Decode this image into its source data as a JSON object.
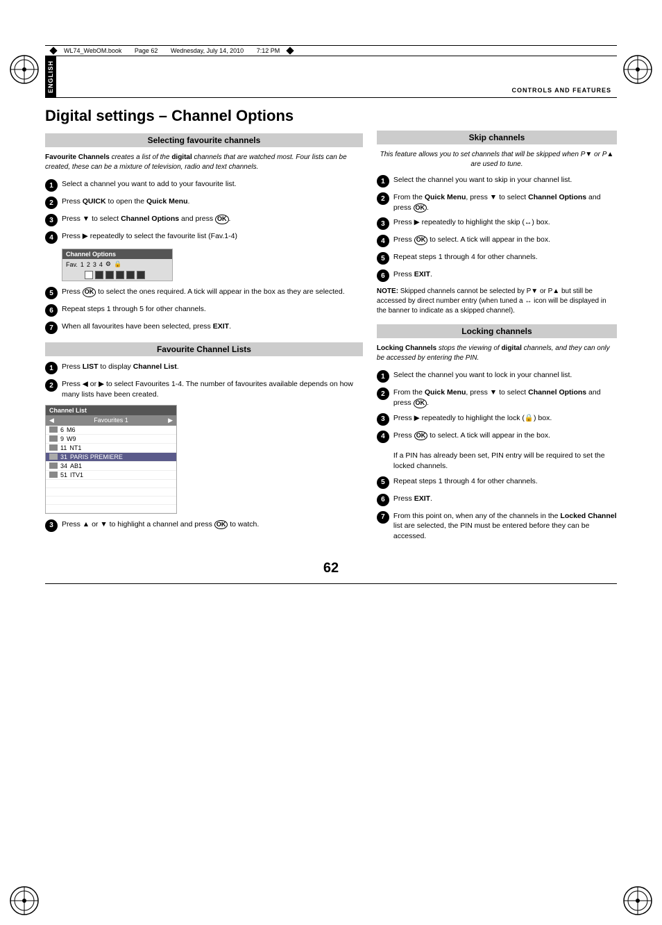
{
  "meta": {
    "file": "WL74_WebOM.book",
    "page": "Page 62",
    "date": "Wednesday, July 14, 2010",
    "time": "7:12 PM"
  },
  "section_label": "CONTROLS AND FEATURES",
  "tab_label": "English",
  "page_title": "Digital settings – Channel Options",
  "page_number": "62",
  "left": {
    "sections": [
      {
        "id": "selecting_favourite",
        "header": "Selecting favourite channels",
        "intro": "Favourite Channels creates a list of the digital channels that are watched most. Four lists can be created, these can be a mixture of television, radio and text channels.",
        "steps": [
          {
            "num": "1",
            "text": "Select a channel you want to add to your favourite list."
          },
          {
            "num": "2",
            "text": "Press QUICK to open the Quick Menu."
          },
          {
            "num": "3",
            "text": "Press ▼ to select Channel Options and press ⊙."
          },
          {
            "num": "4",
            "text": "Press ▶ repeatedly to select the favourite list (Fav.1-4)"
          },
          {
            "num": "5",
            "text": "Press ⊙ to select the ones required. A tick will appear in the box as they are selected."
          },
          {
            "num": "6",
            "text": "Repeat steps 1 through 5 for other channels."
          },
          {
            "num": "7",
            "text": "When all favourites have been selected, press EXIT."
          }
        ],
        "channel_options_box": {
          "title": "Channel Options",
          "row_label": "Fav.",
          "cols": [
            "1",
            "2",
            "3",
            "4",
            "⚙",
            "🔒"
          ],
          "squares": [
            "empty",
            "filled",
            "filled",
            "filled",
            "filled",
            "filled"
          ]
        }
      },
      {
        "id": "favourite_channel_lists",
        "header": "Favourite Channel Lists",
        "steps": [
          {
            "num": "1",
            "text": "Press LIST to display Channel List."
          },
          {
            "num": "2",
            "text": "Press ◀ or ▶ to select Favourites 1-4. The number of favourites available depends on how many lists have been created."
          },
          {
            "num": "3",
            "text": "Press ▲ or ▼ to highlight a channel and press ⊙ to watch."
          }
        ],
        "channel_list_box": {
          "title": "Channel List",
          "nav_label": "Favourites 1",
          "items": [
            {
              "num": "6",
              "name": "M6",
              "highlight": false
            },
            {
              "num": "9",
              "name": "W9",
              "highlight": false
            },
            {
              "num": "11",
              "name": "NT1",
              "highlight": false
            },
            {
              "num": "31",
              "name": "PARIS PREMIERE",
              "highlight": true
            },
            {
              "num": "34",
              "name": "AB1",
              "highlight": false
            },
            {
              "num": "51",
              "name": "ITV1",
              "highlight": false
            }
          ]
        }
      }
    ]
  },
  "right": {
    "sections": [
      {
        "id": "skip_channels",
        "header": "Skip channels",
        "intro": "This feature allows you to set channels that will be skipped when P▼ or P▲ are used to tune.",
        "steps": [
          {
            "num": "1",
            "text": "Select the channel you want to skip in your channel list."
          },
          {
            "num": "2",
            "text": "From the Quick Menu, press ▼ to select Channel Options and press ⊙."
          },
          {
            "num": "3",
            "text": "Press ▶ repeatedly to highlight the skip (↔) box."
          },
          {
            "num": "4",
            "text": "Press ⊙ to select. A tick will appear in the box."
          },
          {
            "num": "5",
            "text": "Repeat steps 1 through 4 for other channels."
          },
          {
            "num": "6",
            "text": "Press EXIT."
          }
        ],
        "note": "NOTE: Skipped channels cannot be selected by P▼ or P▲ but still be accessed by direct number entry (when tuned a ↔ icon will be displayed in the banner to indicate as a skipped channel)."
      },
      {
        "id": "locking_channels",
        "header": "Locking channels",
        "intro": "Locking Channels stops the viewing of digital channels, and they can only be accessed by entering the PIN.",
        "steps": [
          {
            "num": "1",
            "text": "Select the channel you want to lock in your channel list."
          },
          {
            "num": "2",
            "text": "From the Quick Menu, press ▼ to select Channel Options and press ⊙."
          },
          {
            "num": "3",
            "text": "Press ▶ repeatedly to highlight the lock (🔒) box."
          },
          {
            "num": "4",
            "text": "Press ⊙ to select. A tick will appear in the box.\n\nIf a PIN has already been set, PIN entry will be required to set the locked channels."
          },
          {
            "num": "5",
            "text": "Repeat steps 1 through 4 for other channels."
          },
          {
            "num": "6",
            "text": "Press EXIT."
          },
          {
            "num": "7",
            "text": "From this point on, when any of the channels in the Locked Channel list are selected, the PIN must be entered before they can be accessed."
          }
        ]
      }
    ]
  }
}
